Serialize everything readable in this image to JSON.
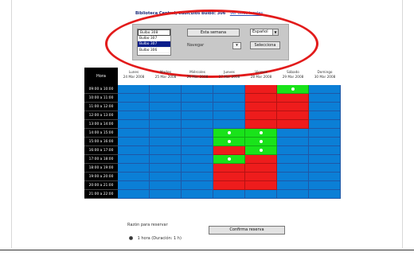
{
  "header": {
    "title": "Biblioteca Central, Cubículos Bulbo: 306",
    "link": "Ver otros locales"
  },
  "controls": {
    "rooms": [
      "Bulbo 308",
      "Bulbo 307",
      "Bulbo 307",
      "Bulbo 306"
    ],
    "selected_room_index": 2,
    "current_room_index": 0,
    "this_week_label": "Esta semana",
    "navigate_label": "Navegar",
    "nav_select_value": "▾",
    "language": "Español",
    "select_label": "Selecciona"
  },
  "schedule": {
    "hour_header": "Hora",
    "days": [
      {
        "name": "Lunes",
        "date": "24 Mar 2008"
      },
      {
        "name": "Martes",
        "date": "25 Mar 2008"
      },
      {
        "name": "Miércoles",
        "date": "26 Mar 2008"
      },
      {
        "name": "Jueves",
        "date": "27 Mar 2008"
      },
      {
        "name": "Viernes",
        "date": "28 Mar 2008"
      },
      {
        "name": "Sábado",
        "date": "29 Mar 2008"
      },
      {
        "name": "Domingo",
        "date": "30 Mar 2008"
      }
    ],
    "hours": [
      "09:00 a 10:00",
      "10:00 a 11:00",
      "11:00 a 12:00",
      "12:00 a 13:00",
      "13:00 a 14:00",
      "14:00 a 15:00",
      "15:00 a 16:00",
      "16:00 a 17:00",
      "17:00 a 18:00",
      "18:00 a 19:00",
      "19:00 a 20:00",
      "20:00 a 21:00",
      "21:00 a 22:00"
    ],
    "legend_note": "F = free (blue), R = reserved (red), S = selectable / own reservation (green)",
    "grid": [
      "FFFFRSF",
      "FFFFRRF",
      "FFFFRRF",
      "FFFFRRF",
      "FFFFRRF",
      "FFFSSFF",
      "FFFSSFF",
      "FFFRSFF",
      "FFFSRFF",
      "FFFRRFF",
      "FFFRRFF",
      "FFFRRFF",
      "FFFFFFF"
    ],
    "dots": [
      [
        0,
        5
      ],
      [
        5,
        3
      ],
      [
        5,
        4
      ],
      [
        6,
        3
      ],
      [
        6,
        4
      ],
      [
        7,
        4
      ],
      [
        8,
        3
      ]
    ]
  },
  "footer": {
    "reason_label": "Razón para reservar",
    "confirm_label": "Confirma reserva",
    "duration_text": "1 hora (Duración: 1 h)"
  },
  "colors": {
    "free": "#0b7fd6",
    "reserved": "#ee1c1c",
    "available_selected": "#19e31a",
    "highlight": "#e21b1b"
  }
}
